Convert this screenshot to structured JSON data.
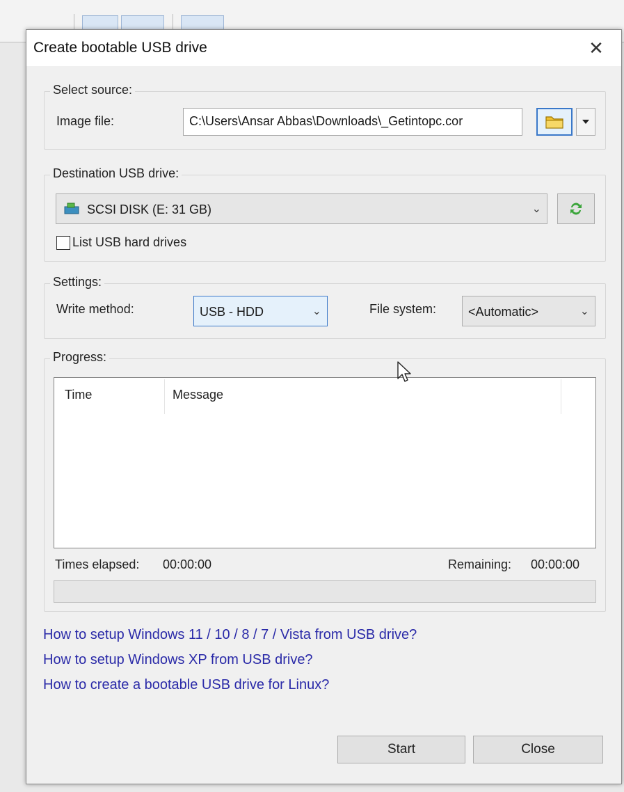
{
  "dialog": {
    "title": "Create bootable USB drive",
    "close_glyph": "✕"
  },
  "source": {
    "group_label": "Select source:",
    "image_file_label": "Image file:",
    "image_file_value": "C:\\Users\\Ansar Abbas\\Downloads\\_Getintopc.cor",
    "browse_icon": "folder-icon",
    "menu_icon": "dropdown-arrow-icon"
  },
  "destination": {
    "group_label": "Destination USB drive:",
    "selected_drive": "SCSI DISK (E:  31 GB)",
    "drive_icon": "usb-drive-icon",
    "refresh_icon": "refresh-icon",
    "list_hard_drives_label": "List USB hard drives",
    "list_hard_drives_checked": false
  },
  "settings": {
    "group_label": "Settings:",
    "write_method_label": "Write method:",
    "write_method_value": "USB - HDD",
    "file_system_label": "File system:",
    "file_system_value": "<Automatic>"
  },
  "progress": {
    "group_label": "Progress:",
    "columns": [
      "Time",
      "Message"
    ],
    "elapsed_label": "Times elapsed:",
    "elapsed_value": "00:00:00",
    "remaining_label": "Remaining:",
    "remaining_value": "00:00:00",
    "percent": 0
  },
  "links": [
    "How to setup Windows 11 / 10 / 8 / 7 / Vista from USB drive?",
    "How to setup Windows XP from USB drive?",
    "How to create a bootable USB drive for Linux?"
  ],
  "buttons": {
    "start": "Start",
    "close": "Close"
  },
  "colors": {
    "link": "#2a2aa8",
    "focus": "#3a78c9",
    "folder": "#f1c232",
    "refresh": "#3aa53a"
  }
}
